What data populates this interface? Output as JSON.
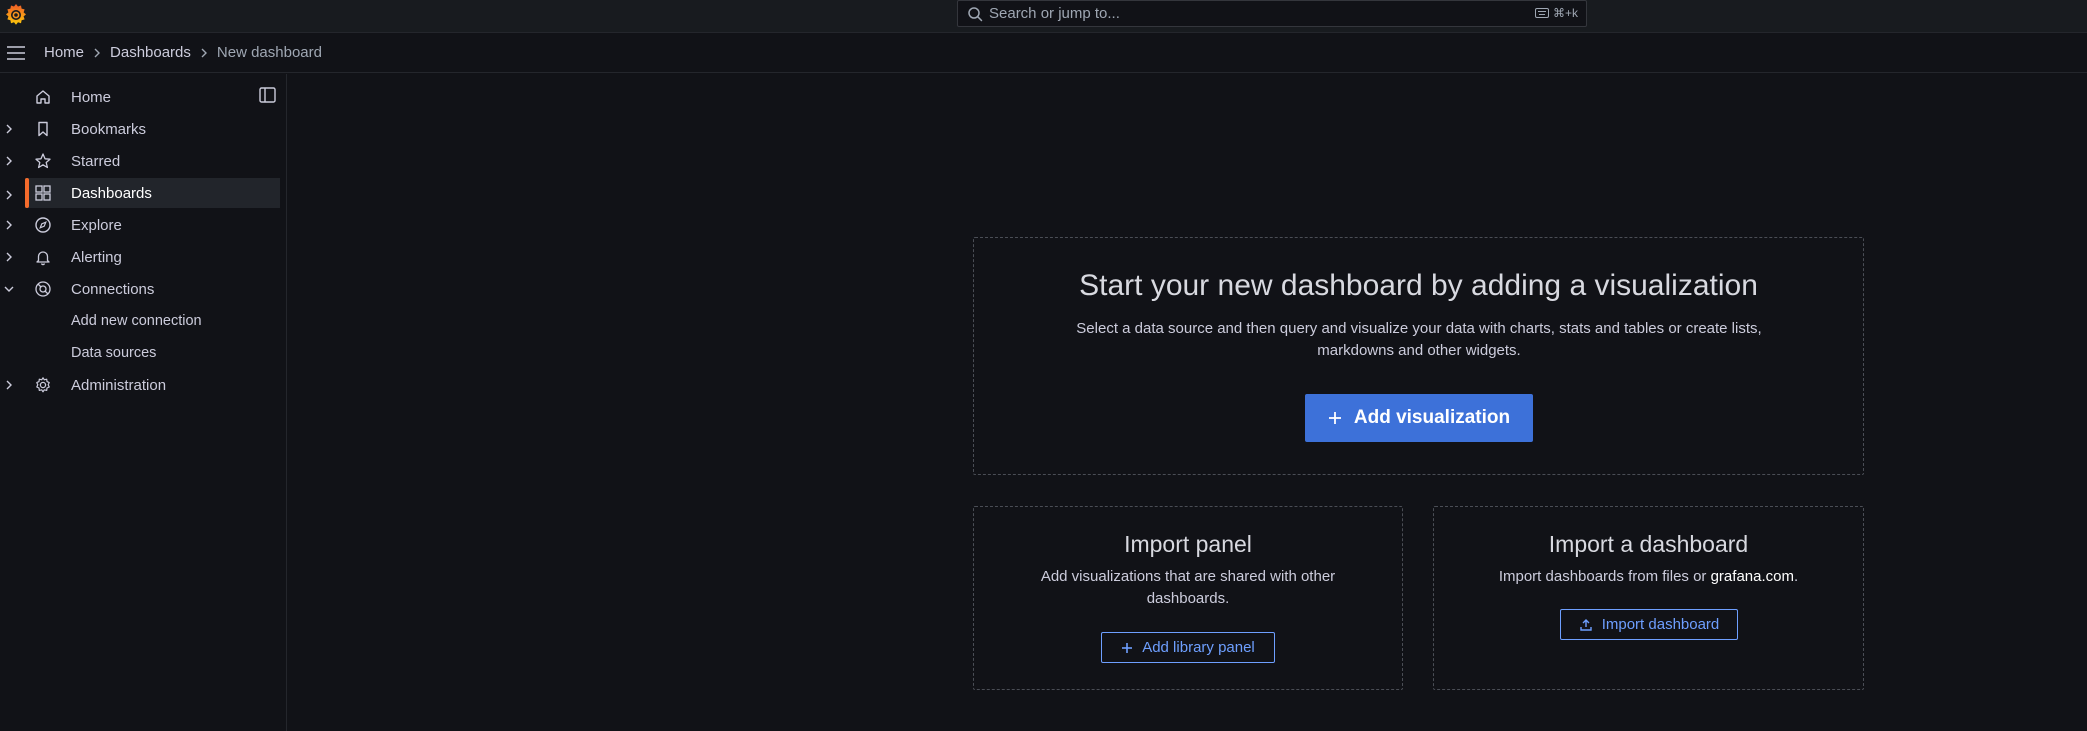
{
  "topbar": {
    "logo": "grafana-logo",
    "search": {
      "placeholder": "Search or jump to...",
      "shortcut": "⌘+k"
    }
  },
  "breadcrumb": [
    {
      "label": "Home"
    },
    {
      "label": "Dashboards"
    },
    {
      "label": "New dashboard"
    }
  ],
  "sidebar": {
    "items": [
      {
        "label": "Home",
        "icon": "home-icon",
        "expandable": false
      },
      {
        "label": "Bookmarks",
        "icon": "bookmark-icon",
        "expandable": true
      },
      {
        "label": "Starred",
        "icon": "star-icon",
        "expandable": true
      },
      {
        "label": "Dashboards",
        "icon": "dashboards-icon",
        "expandable": true,
        "active": true
      },
      {
        "label": "Explore",
        "icon": "compass-icon",
        "expandable": true
      },
      {
        "label": "Alerting",
        "icon": "bell-icon",
        "expandable": true
      },
      {
        "label": "Connections",
        "icon": "connections-icon",
        "expandable": true,
        "expanded": true
      },
      {
        "label": "Add new connection",
        "sub": true
      },
      {
        "label": "Data sources",
        "sub": true
      },
      {
        "label": "Administration",
        "icon": "gear-icon",
        "expandable": true
      }
    ]
  },
  "main": {
    "title": "Start your new dashboard by adding a visualization",
    "description": "Select a data source and then query and visualize your data with charts, stats and tables or create lists, markdowns and other widgets.",
    "add_visualization_label": "Add visualization",
    "import_panel": {
      "title": "Import panel",
      "description": "Add visualizations that are shared with other dashboards.",
      "button_label": "Add library panel"
    },
    "import_dashboard": {
      "title": "Import a dashboard",
      "description_prefix": "Import dashboards from files or ",
      "link_text": "grafana.com",
      "description_suffix": ".",
      "button_label": "Import dashboard"
    }
  },
  "colors": {
    "accent": "#f46b2c",
    "primary_button": "#3d71d9",
    "link_blue": "#6e9fff",
    "background": "#111217"
  }
}
